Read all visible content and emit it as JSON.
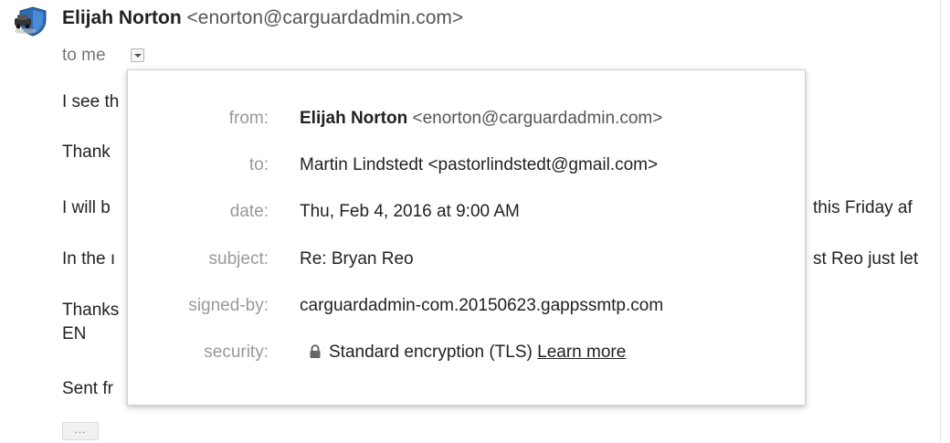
{
  "email": {
    "sender_name": "Elijah Norton",
    "sender_email": "<enorton@carguardadmin.com>",
    "to_me": "to me"
  },
  "body_lines": {
    "line1": "I see th",
    "line2": "Thank",
    "line3": "I will b",
    "line3_right": "this Friday af",
    "line4": "In the ı",
    "line4_right": "st Reo just let",
    "line5a": "Thanks",
    "line5b": "EN",
    "line6": "Sent fr",
    "ellipsis": "..."
  },
  "details": {
    "from_label": "from:",
    "from_name": "Elijah Norton",
    "from_email": "<enorton@carguardadmin.com>",
    "to_label": "to:",
    "to_value": "Martin Lindstedt <pastorlindstedt@gmail.com>",
    "date_label": "date:",
    "date_value": "Thu, Feb 4, 2016 at 9:00 AM",
    "subject_label": "subject:",
    "subject_value": "Re: Bryan Reo",
    "signed_label": "signed-by:",
    "signed_value": "carguardadmin-com.20150623.gappssmtp.com",
    "security_label": "security:",
    "security_value": "Standard encryption (TLS)",
    "learn_more": "Learn more"
  },
  "icons": {
    "avatar": "shield-car-avatar-icon",
    "dropdown": "chevron-down-icon",
    "lock": "lock-icon"
  }
}
